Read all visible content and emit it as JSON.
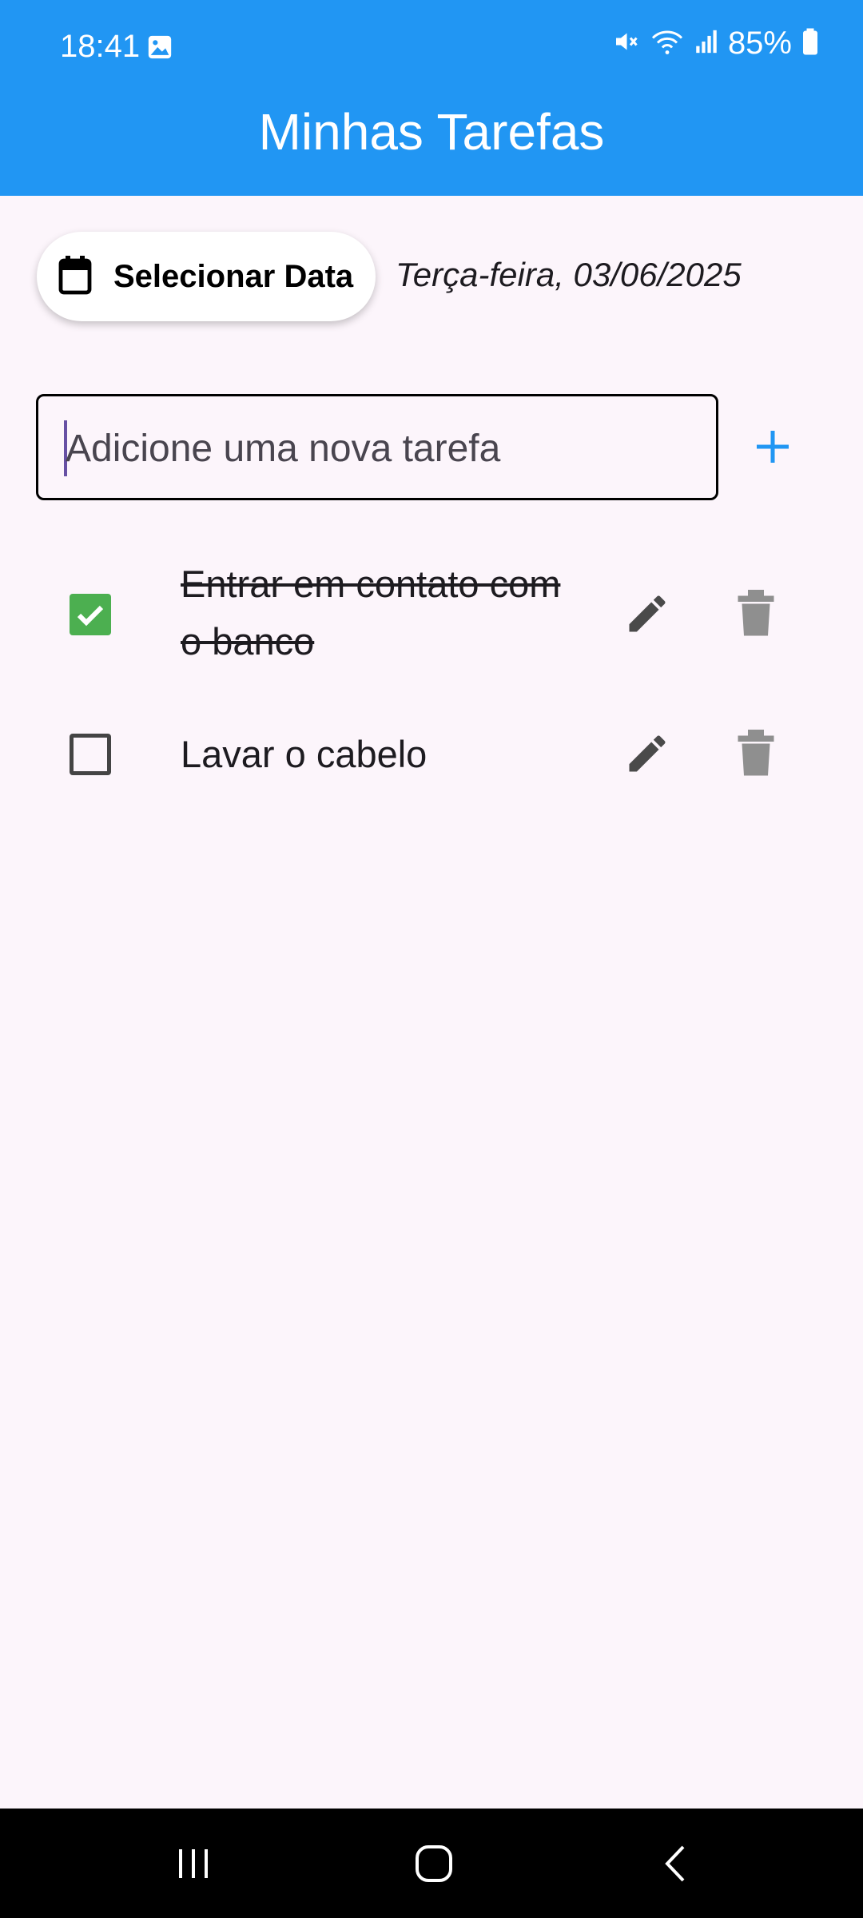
{
  "status_bar": {
    "time": "18:41",
    "battery": "85%",
    "icons": [
      "image-icon",
      "mute-icon",
      "wifi-icon",
      "signal-icon",
      "battery-icon"
    ]
  },
  "app_bar": {
    "title": "Minhas Tarefas",
    "color": "#2196f3"
  },
  "date_picker": {
    "button_label": "Selecionar Data",
    "icon": "calendar-icon",
    "selected_date": "Terça-feira, 03/06/2025"
  },
  "new_task": {
    "placeholder": "Adicione uma nova tarefa",
    "value": "",
    "add_icon": "plus-icon",
    "accent": "#2196f3"
  },
  "tasks": [
    {
      "title": "Entrar em contato com o banco",
      "done": true
    },
    {
      "title": "Lavar o cabelo",
      "done": false
    }
  ],
  "colors": {
    "checked": "#4caf50",
    "background": "#fcf5fb"
  },
  "nav_bar": {
    "icons": [
      "recents-icon",
      "home-icon",
      "back-icon"
    ]
  }
}
